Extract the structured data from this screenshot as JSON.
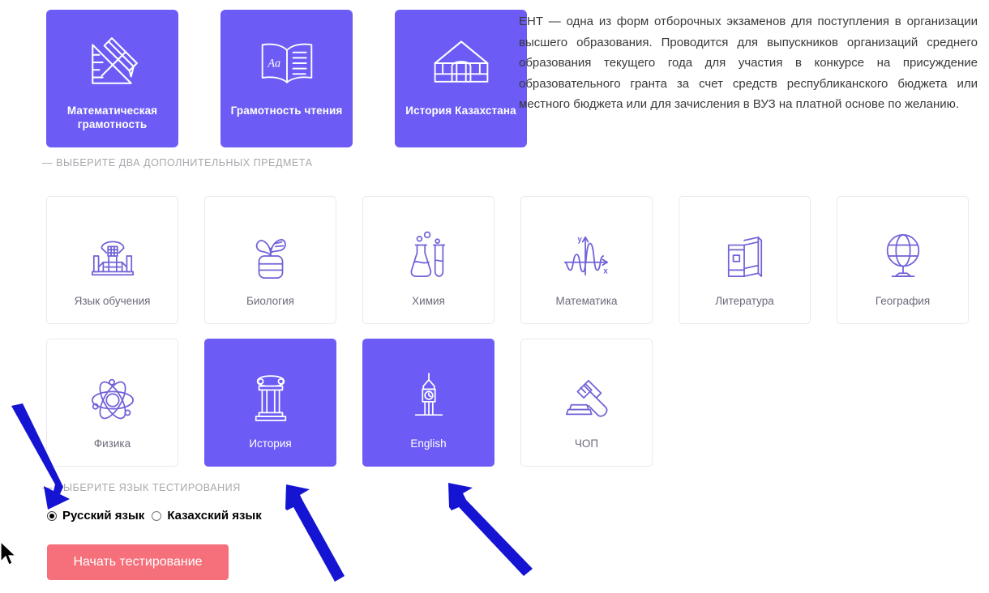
{
  "intro": {
    "text": "ЕНТ — одна из форм отборочных экзаменов для поступления в организации высшего образования. Проводится для выпускников организаций среднего образования текущего года для участия в конкурсе на присуждение образовательного гранта за счет средств республиканского бюджета или местного бюджета или для зачисления в ВУЗ на платной основе по желанию."
  },
  "colors": {
    "accent_purple": "#6c5cf5",
    "card_border": "#e9e9ef",
    "label_gray": "#a8a8ae",
    "subject_text": "#6b6b7b",
    "start_button": "#f5707a",
    "arrow_blue": "#1414d2"
  },
  "required_subjects": [
    {
      "label": "Математическая грамотность",
      "icon": "ruler-pencil-icon",
      "selected": true
    },
    {
      "label": "Грамотность чтения",
      "icon": "open-book-icon",
      "selected": true
    },
    {
      "label": "История Казахстана",
      "icon": "yurt-icon",
      "selected": true
    }
  ],
  "captions": {
    "subjects": "— ВЫБЕРИТЕ ДВА ДОПОЛНИТЕЛЬНЫХ ПРЕДМЕТА",
    "language": "— ВЫБЕРИТЕ ЯЗЫК ТЕСТИРОВАНИЯ"
  },
  "optional_subjects": [
    [
      {
        "label": "Язык обучения",
        "icon": "lectern-icon",
        "selected": false
      },
      {
        "label": "Биология",
        "icon": "plant-pot-icon",
        "selected": false
      },
      {
        "label": "Химия",
        "icon": "flask-tube-icon",
        "selected": false
      },
      {
        "label": "Математика",
        "icon": "graph-curve-icon",
        "selected": false
      },
      {
        "label": "Литература",
        "icon": "books-icon",
        "selected": false
      },
      {
        "label": "География",
        "icon": "globe-icon",
        "selected": false
      }
    ],
    [
      {
        "label": "Физика",
        "icon": "atom-icon",
        "selected": false
      },
      {
        "label": "История",
        "icon": "column-icon",
        "selected": true
      },
      {
        "label": "English",
        "icon": "big-ben-icon",
        "selected": true
      },
      {
        "label": "ЧОП",
        "icon": "gavel-icon",
        "selected": false
      }
    ]
  ],
  "languages": [
    {
      "label": "Русский язык",
      "selected": true
    },
    {
      "label": "Казахский язык",
      "selected": false
    }
  ],
  "start_button": {
    "label": "Начать тестирование"
  },
  "annotations": {
    "arrows": [
      {
        "name": "arrow-to-language-section",
        "direction": "down-right"
      },
      {
        "name": "arrow-to-history-card",
        "direction": "up-left"
      },
      {
        "name": "arrow-to-english-card",
        "direction": "up-left"
      }
    ],
    "cursor": "mouse-pointer"
  }
}
